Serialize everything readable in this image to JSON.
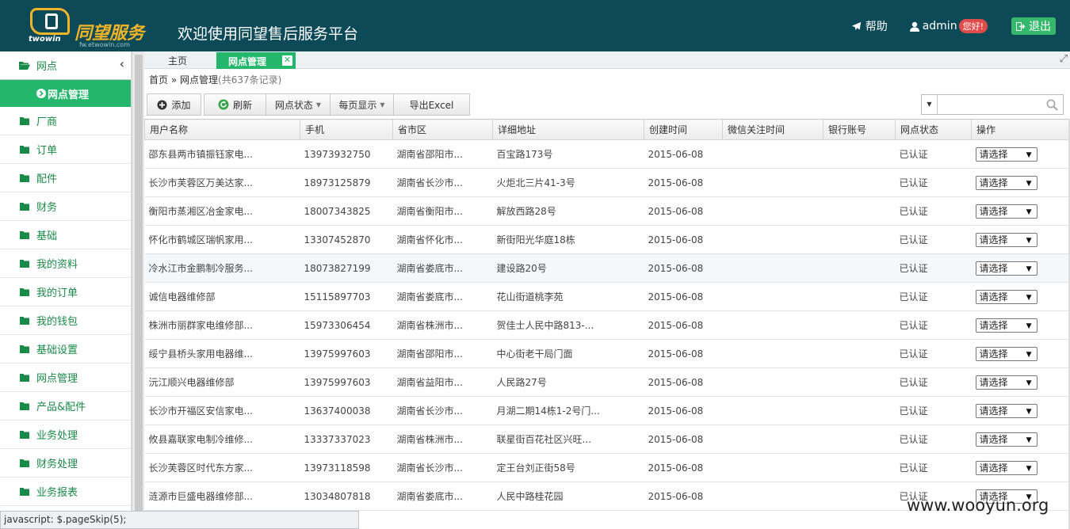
{
  "header": {
    "logo_text": "同望服务",
    "logo_sub": "twowin",
    "logo_url": "fw.etwowin.com",
    "title": "欢迎使用同望售后服务平台",
    "help": "帮助",
    "user": "admin",
    "greeting": "您好!",
    "logout": "退出",
    "colors": {
      "bar": "#0c4a58",
      "accent": "#22b76b",
      "badge": "#e04b4b"
    }
  },
  "sidebar": {
    "head": "网点",
    "active": "网点管理",
    "items": [
      "厂商",
      "订单",
      "配件",
      "财务",
      "基础",
      "我的资料",
      "我的订单",
      "我的钱包",
      "基础设置",
      "网点管理",
      "产品&配件",
      "业务处理",
      "财务处理",
      "业务报表"
    ]
  },
  "tabs": {
    "home": "主页",
    "active": "网点管理"
  },
  "breadcrumb": {
    "home": "首页",
    "sep": "»",
    "page": "网点管理",
    "count": "(共637条记录)"
  },
  "toolbar": {
    "add": "添加",
    "refresh": "刷新",
    "status": "网点状态",
    "per_page": "每页显示",
    "export": "导出Excel"
  },
  "table": {
    "columns": [
      "用户名称",
      "手机",
      "省市区",
      "详细地址",
      "创建时间",
      "微信关注时间",
      "银行账号",
      "网点状态",
      "操作"
    ],
    "select_label": "请选择",
    "rows": [
      [
        "邵东县两市镇振钰家电...",
        "13973932750",
        "湖南省邵阳市...",
        "百宝路173号",
        "2015-06-08",
        "",
        "",
        "已认证"
      ],
      [
        "长沙市芙蓉区万美达家...",
        "18973125879",
        "湖南省长沙市...",
        "火炬北三片41-3号",
        "2015-06-08",
        "",
        "",
        "已认证"
      ],
      [
        "衡阳市蒸湘区冶金家电...",
        "18007343825",
        "湖南省衡阳市...",
        "解放西路28号",
        "2015-06-08",
        "",
        "",
        "已认证"
      ],
      [
        "怀化市鹤城区瑞帆家用...",
        "13307452870",
        "湖南省怀化市...",
        "新街阳光华庭18栋",
        "2015-06-08",
        "",
        "",
        "已认证"
      ],
      [
        "冷水江市金鹏制冷服务...",
        "18073827199",
        "湖南省娄底市...",
        "建设路20号",
        "2015-06-08",
        "",
        "",
        "已认证"
      ],
      [
        "诚信电器维修部",
        "15115897703",
        "湖南省娄底市...",
        "花山街道桃李苑",
        "2015-06-08",
        "",
        "",
        "已认证"
      ],
      [
        "株洲市丽群家电维修部...",
        "15973306454",
        "湖南省株洲市...",
        "贺佳士人民中路813-...",
        "2015-06-08",
        "",
        "",
        "已认证"
      ],
      [
        "绥宁县桥头家用电器维...",
        "13975997603",
        "湖南省邵阳市...",
        "中心街老干局门面",
        "2015-06-08",
        "",
        "",
        "已认证"
      ],
      [
        "沅江顺兴电器维修部",
        "13975997603",
        "湖南省益阳市...",
        "人民路27号",
        "2015-06-08",
        "",
        "",
        "已认证"
      ],
      [
        "长沙市开福区安信家电...",
        "13637400038",
        "湖南省长沙市...",
        "月湖二期14栋1-2号门...",
        "2015-06-08",
        "",
        "",
        "已认证"
      ],
      [
        "攸县嘉联家电制冷维修...",
        "13337337023",
        "湖南省株洲市...",
        "联星街百花社区兴旺...",
        "2015-06-08",
        "",
        "",
        "已认证"
      ],
      [
        "长沙芙蓉区时代东方家...",
        "13973118598",
        "湖南省长沙市...",
        "定王台刘正街58号",
        "2015-06-08",
        "",
        "",
        "已认证"
      ],
      [
        "涟源市巨盛电器维修部...",
        "13034807818",
        "湖南省娄底市...",
        "人民中路桂花园",
        "2015-06-08",
        "",
        "",
        "已认证"
      ]
    ]
  },
  "statusbar": "javascript: $.pageSkip(5);",
  "watermark": "www.wooyun.org"
}
